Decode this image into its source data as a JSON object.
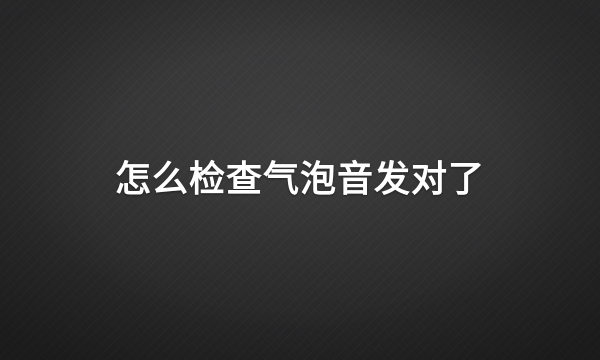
{
  "card": {
    "title": "怎么检查气泡音发对了"
  }
}
